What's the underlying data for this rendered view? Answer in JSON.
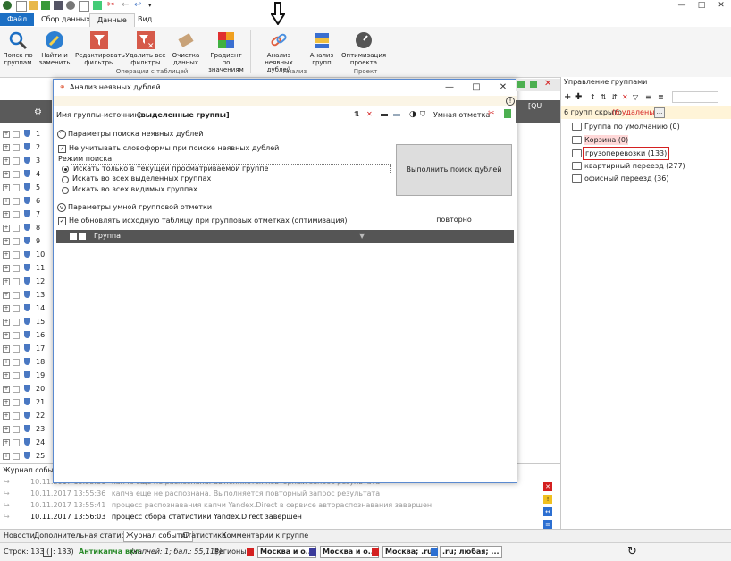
{
  "window": {
    "minimize": "—",
    "maximize": "□",
    "close": "✕"
  },
  "tabs": {
    "file": "Файл",
    "collect": "Сбор данных",
    "data": "Данные",
    "view": "Вид"
  },
  "ribbon": {
    "search_groups": "Поиск по группам",
    "find_replace": "Найти и заменить",
    "edit_filters": "Редактировать фильтры",
    "remove_filters": "Удалить все фильтры",
    "clear_data": "Очистка данных",
    "gradient": "Градиент по значениям",
    "implicit_dupes": "Анализ неявных дублей",
    "group_analysis": "Анализ групп",
    "optimization": "Оптимизация проекта",
    "group_table_ops": "Операции с таблицей",
    "group_analysis_label": "Анализ",
    "group_project_label": "Проект"
  },
  "grid": {
    "rows": [
      "1",
      "2",
      "3",
      "4",
      "5",
      "6",
      "7",
      "8",
      "9",
      "10",
      "11",
      "12",
      "13",
      "14",
      "15",
      "16",
      "17",
      "18",
      "19",
      "20",
      "21",
      "22",
      "23",
      "24",
      "25"
    ]
  },
  "right_panel": {
    "title": "Управление группами",
    "hidden_info": "6 групп скрыто",
    "deleted_info": "(6 удалены)",
    "more_btn": "...",
    "groups": [
      {
        "label": "Группа по умолчанию (0)"
      },
      {
        "label": "Корзина (0)"
      },
      {
        "label": "грузоперевозки (133)"
      },
      {
        "label": "квартирный переезд (277)"
      },
      {
        "label": "офисный переезд (36)"
      }
    ]
  },
  "dialog": {
    "title": "Анализ неявных дублей",
    "source_label": "Имя группы-источника:",
    "source_value": "[выделенные группы]",
    "smart_mark": "Умная отметка",
    "section1": "Параметры поиска неявных дублей",
    "ignore_stopwords": "Не учитывать словоформы при поиске неявных дублей",
    "mode_label": "Режим поиска",
    "mode_current": "Искать только в текущей просматриваемой группе",
    "mode_selected": "Искать во всех выделенных группах",
    "mode_visible": "Искать во всех видимых группах",
    "run_button": "Выполнить поиск дублей повторно",
    "section2": "Параметры умной групповой отметки",
    "no_update": "Не обновлять исходную таблицу при групповых отметках (оптимизация)",
    "table_header_group": "Группа",
    "right_col_text": "[QU"
  },
  "log": {
    "title": "Журнал событи",
    "lines": [
      {
        "time": "10.11.2017 13:55:31",
        "text": "капча еще не распознана. Выполняется повторный запрос результата",
        "dim": true
      },
      {
        "time": "10.11.2017 13:55:36",
        "text": "капча еще не распознана. Выполняется повторный запрос результата",
        "dim": true
      },
      {
        "time": "10.11.2017 13:55:41",
        "text": "процесс распознавания капчи Yandex.Direct в сервисе автораспознавания завершен",
        "dim": true
      },
      {
        "time": "10.11.2017 13:56:03",
        "text": "процесс сбора статистики Yandex.Direct завершен",
        "dim": false
      }
    ]
  },
  "bottom_tabs": [
    "Новости",
    "Дополнительная статистика",
    "Журнал событий",
    "Статистика",
    "Комментарии к группе"
  ],
  "status": {
    "rows": "Строк: 133 (",
    "rows_count": ": 133)",
    "anticaptcha": "Антикапча вкл.",
    "anticaptcha_info": "(капчей: 1; бал.: 55,11$)",
    "regions_label": "Регионы:",
    "regions": [
      "Москва и о...",
      "Москва и о...",
      "Москва; .ru;",
      ".ru; любая; ..."
    ]
  },
  "colors": {
    "accent": "#1c6fc4",
    "red": "#d42020",
    "headerDark": "#5a5a5a"
  }
}
